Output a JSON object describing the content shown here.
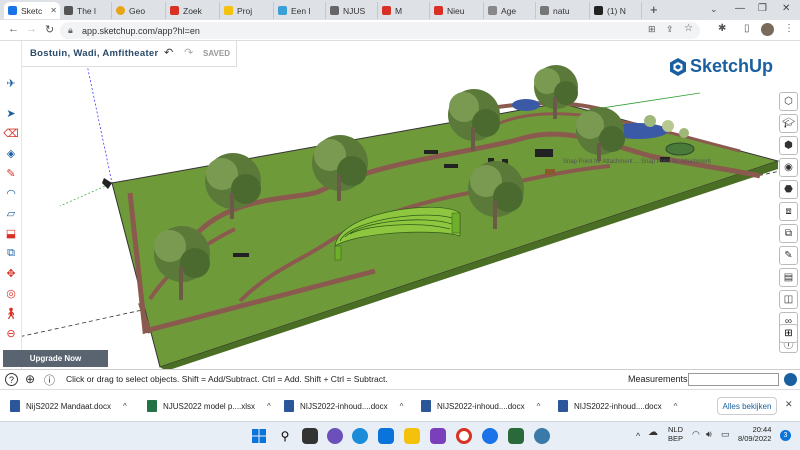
{
  "browser": {
    "tabs": [
      {
        "label": "Sketc",
        "color": "#1a73e8",
        "active": true
      },
      {
        "label": "The l",
        "color": "#555555"
      },
      {
        "label": "Geo",
        "color": "#e8a317"
      },
      {
        "label": "Zoek",
        "color": "#d93025"
      },
      {
        "label": "Proj",
        "color": "#f4c20d"
      },
      {
        "label": "Een l",
        "color": "#3aa0d8"
      },
      {
        "label": "NJUS",
        "color": "#666666"
      },
      {
        "label": "M",
        "color": "#d93025"
      },
      {
        "label": "Nieu",
        "color": "#d93025"
      },
      {
        "label": "Age",
        "color": "#888888"
      },
      {
        "label": "natu",
        "color": "#777777"
      },
      {
        "label": "(1) N",
        "color": "#222222"
      }
    ],
    "new_tab_label": "+",
    "url": "app.sketchup.com/app?hl=en"
  },
  "app": {
    "model_title": "Bostuin, Wadi, Amfitheater",
    "save_state": "SAVED",
    "brand_name": "SketchUp",
    "upgrade_label": "Upgrade Now",
    "snap_hint": "Snap Point for Attachment ... Snap Point for Attachment",
    "status_text": "Click or drag to select objects. Shift = Add/Subtract. Ctrl = Add. Shift + Ctrl = Subtract.",
    "measurements_label": "Measurements",
    "measurements_value": ""
  },
  "downloads": {
    "items": [
      {
        "name": "NijS2022 Mandaat.docx",
        "type": "docx"
      },
      {
        "name": "NJUS2022 model p....xlsx",
        "type": "xlsx"
      },
      {
        "name": "NIJS2022-inhoud....docx",
        "type": "docx"
      },
      {
        "name": "NIJS2022-inhoud....docx",
        "type": "docx"
      },
      {
        "name": "NIJS2022-inhoud....docx",
        "type": "docx"
      }
    ],
    "show_all_label": "Alles bekijken"
  },
  "taskbar": {
    "language": "NLD",
    "layout": "BEP",
    "time": "20:44",
    "date": "8/09/2022",
    "notification_count": "3"
  }
}
